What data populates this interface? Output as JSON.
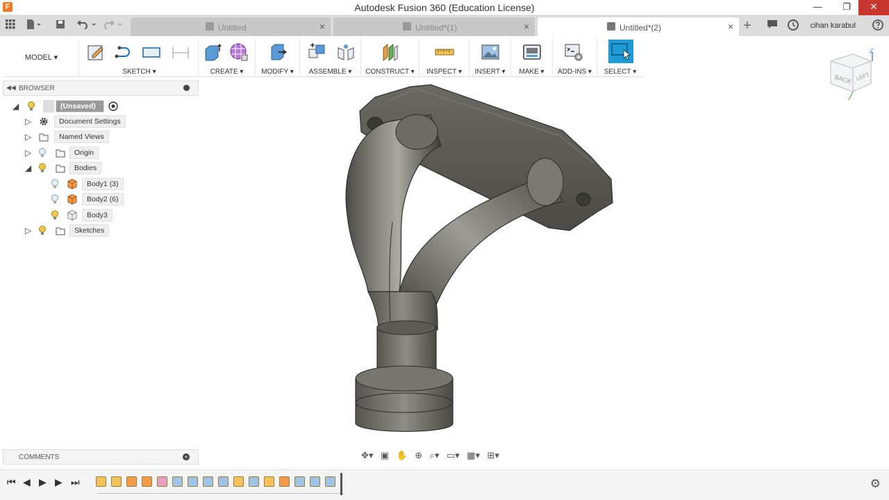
{
  "window": {
    "title": "Autodesk Fusion 360 (Education License)",
    "app_icon": "F",
    "minimize": "—",
    "restore": "❐",
    "close": "✕"
  },
  "tabs": [
    {
      "label": "Untitled",
      "close": "×"
    },
    {
      "label": "Untitled*(1)",
      "close": "×"
    },
    {
      "label": "Untitled*(2)",
      "close": "×"
    }
  ],
  "user": {
    "name": "cihan karabul"
  },
  "toolbar": {
    "workspace": "MODEL ▾",
    "groups": [
      {
        "label": "SKETCH ▾"
      },
      {
        "label": "CREATE ▾"
      },
      {
        "label": "MODIFY ▾"
      },
      {
        "label": "ASSEMBLE ▾"
      },
      {
        "label": "CONSTRUCT ▾"
      },
      {
        "label": "INSPECT ▾"
      },
      {
        "label": "INSERT ▾"
      },
      {
        "label": "MAKE ▾"
      },
      {
        "label": "ADD-INS ▾"
      },
      {
        "label": "SELECT ▾"
      }
    ]
  },
  "browser": {
    "title": "BROWSER",
    "root": "(Unsaved)",
    "items": [
      {
        "label": "Document Settings"
      },
      {
        "label": "Named Views"
      },
      {
        "label": "Origin"
      },
      {
        "label": "Bodies"
      },
      {
        "label": "Body1 (3)"
      },
      {
        "label": "Body2 (6)"
      },
      {
        "label": "Body3"
      },
      {
        "label": "Sketches"
      }
    ]
  },
  "comments": {
    "title": "COMMENTS"
  },
  "viewcube": {
    "faces": [
      "BACK",
      "LEFT"
    ],
    "axis": "Z"
  },
  "colors": {
    "accent": "#1f9bd7",
    "close_btn": "#c7372f",
    "timeline_step": "#f3c25b"
  }
}
